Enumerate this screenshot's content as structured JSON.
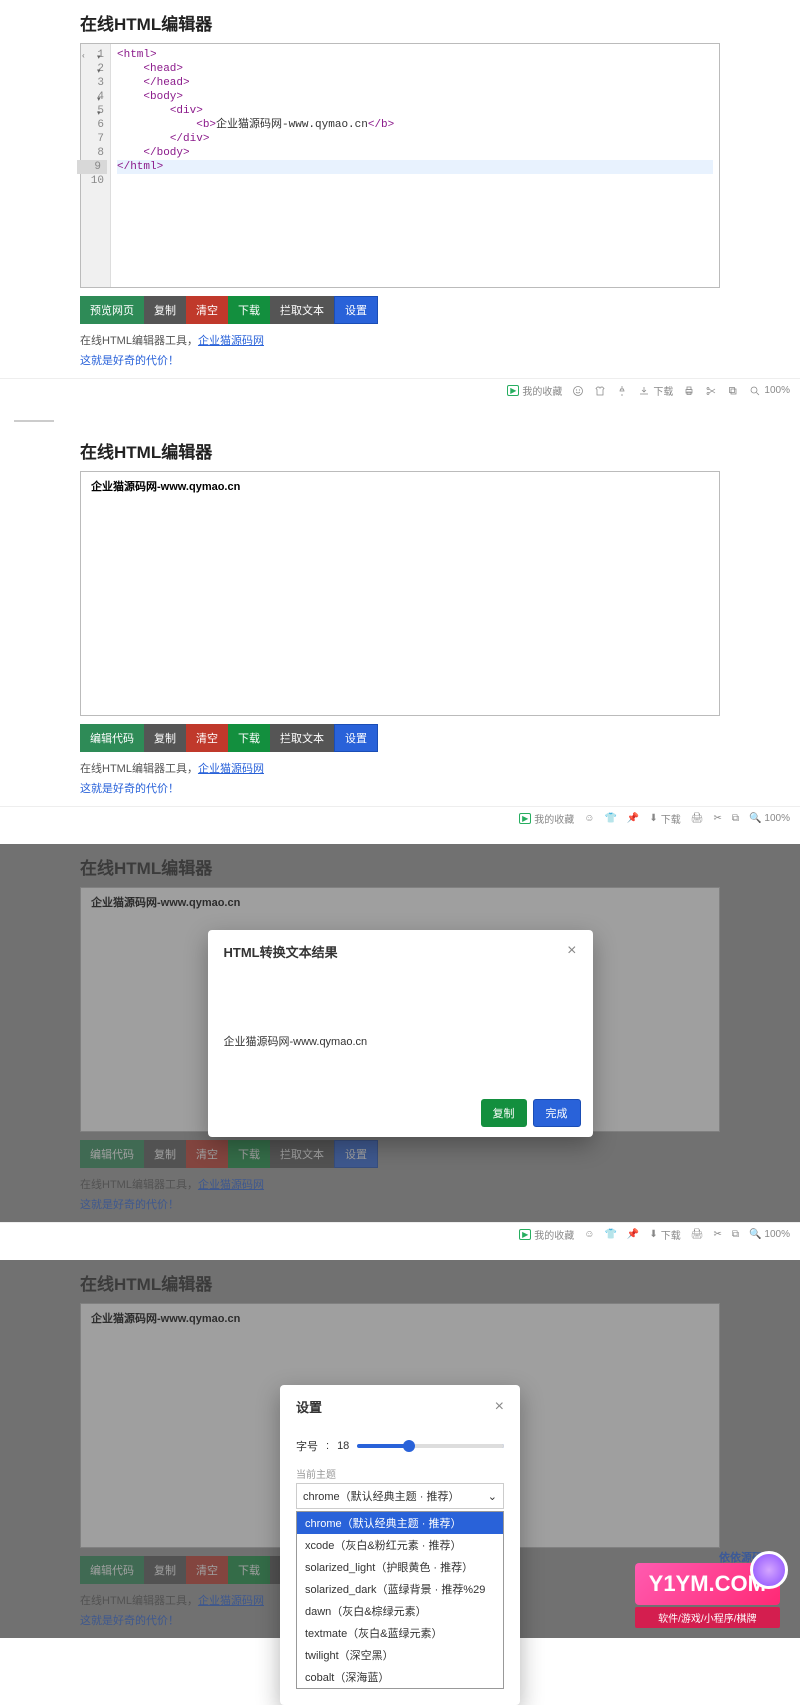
{
  "title": "在线HTML编辑器",
  "code": {
    "lines": [
      "<html>",
      "    <head>",
      "    </head>",
      "    <body>",
      "        <div>",
      "            <b>企业猫源码网-www.qymao.cn</b>",
      "        </div>",
      "    </body>",
      "</html>",
      ""
    ],
    "gutter": [
      "1",
      "2",
      "3",
      "4",
      "5",
      "6",
      "7",
      "8",
      "9",
      "10"
    ],
    "active_line": 9
  },
  "preview_text": "企业猫源码网-www.qymao.cn",
  "buttons": {
    "preview": "预览网页",
    "edit": "编辑代码",
    "copy": "复制",
    "clear": "清空",
    "download": "下载",
    "extract": "拦取文本",
    "settings": "设置"
  },
  "footer": {
    "text_prefix": "在线HTML编辑器工具，",
    "link": "企业猫源码网",
    "tagline": "这就是好奇的代价！"
  },
  "bottombar": {
    "collect": "我的收藏",
    "download": "下载",
    "zoom": "100%"
  },
  "text_modal": {
    "title": "HTML转换文本结果",
    "content": "企业猫源码网-www.qymao.cn",
    "copy": "复制",
    "done": "完成"
  },
  "settings_modal": {
    "title": "设置",
    "font_label": "字号",
    "font_value": "18",
    "theme_label": "当前主题",
    "theme_selected": "chrome（默认经典主题 · 推荐）",
    "options": [
      "chrome（默认经典主题 · 推荐）",
      "xcode（灰白&粉红元素 · 推荐）",
      "solarized_light（护眼黄色 · 推荐）",
      "solarized_dark（蓝绿背景 · 推荐%29",
      "dawn（灰白&棕绿元素）",
      "textmate（灰白&蓝绿元素）",
      "twilight（深空黑）",
      "cobalt（深海蓝）"
    ]
  },
  "watermark": {
    "top": "依依源码网",
    "main": "Y1YM.COM",
    "sub": "软件/游戏/小程序/棋牌"
  }
}
